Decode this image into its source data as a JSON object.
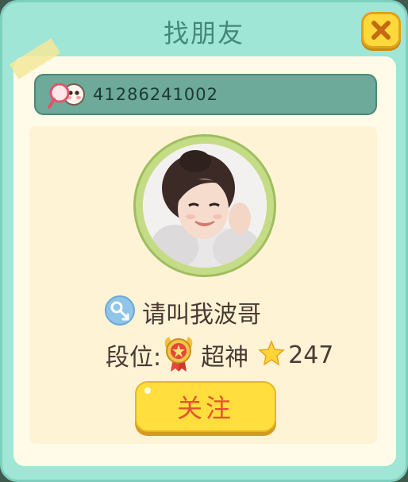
{
  "dialog": {
    "title": "找朋友"
  },
  "search": {
    "value": "41286241002",
    "icon": "magnifier-face-icon"
  },
  "profile": {
    "name": "请叫我波哥",
    "gender_icon": "male-icon",
    "rank_label": "段位:",
    "rank_name": "超神",
    "rank_icon": "rank-medal-icon",
    "star_icon": "star-icon",
    "star_count": "247"
  },
  "actions": {
    "follow_label": "关注",
    "close_icon": "close-icon"
  },
  "colors": {
    "panel_bg": "#9fe6d7",
    "inner_bg": "#fffbe8",
    "search_bg": "#6daa9a",
    "button_yellow": "#ffde3e",
    "follow_text": "#e2542a"
  }
}
